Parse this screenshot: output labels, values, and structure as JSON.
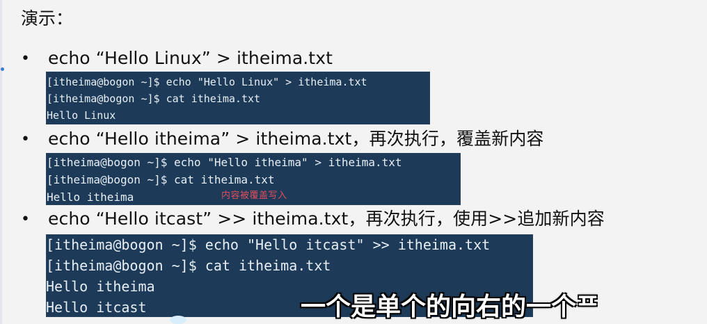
{
  "page": {
    "title": "演示："
  },
  "bullets": [
    {
      "symbol": "•",
      "text": "echo “Hello Linux” > itheima.txt",
      "terminal": [
        "[itheima@bogon ~]$ echo \"Hello Linux\" > itheima.txt",
        "[itheima@bogon ~]$ cat itheima.txt",
        "Hello Linux"
      ]
    },
    {
      "symbol": "•",
      "text": "echo “Hello itheima” > itheima.txt，再次执行，覆盖新内容",
      "terminal": [
        "[itheima@bogon ~]$ echo \"Hello itheima\" > itheima.txt",
        "[itheima@bogon ~]$ cat itheima.txt",
        "Hello itheima"
      ],
      "annotation": "内容被覆盖写入"
    },
    {
      "symbol": "•",
      "text": "echo “Hello itcast” >> itheima.txt，再次执行，使用>>追加新内容",
      "terminal": [
        "[itheima@bogon ~]$ echo \"Hello itcast\" >> itheima.txt",
        "[itheima@bogon ~]$ cat itheima.txt",
        "Hello itheima",
        "Hello itcast"
      ]
    }
  ],
  "subtitle": "一个是单个的向右的一个ᄑ"
}
